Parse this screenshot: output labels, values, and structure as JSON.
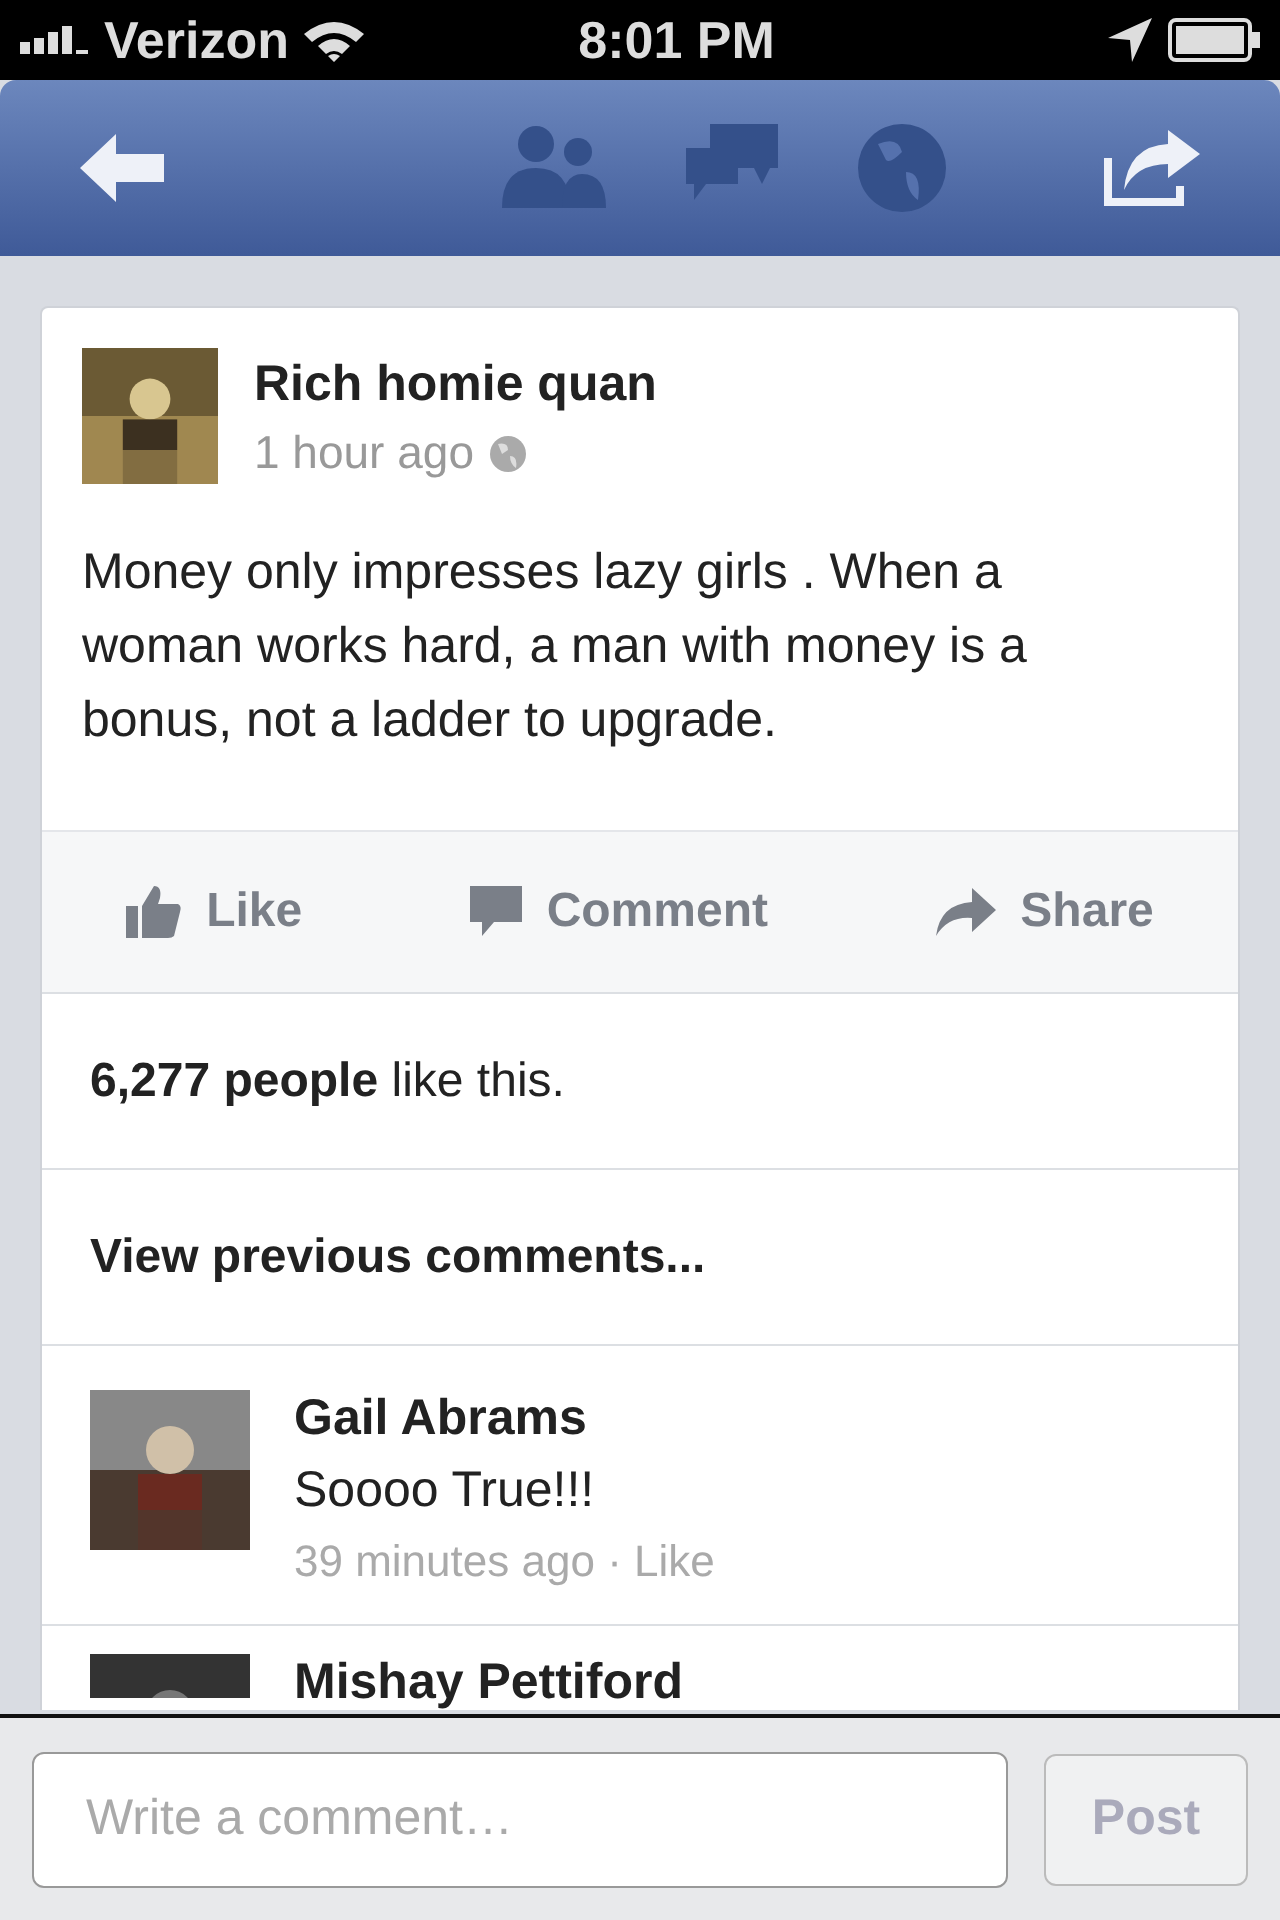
{
  "status_bar": {
    "carrier": "Verizon",
    "time": "8:01 PM"
  },
  "post": {
    "author": "Rich homie quan",
    "time": "1 hour ago",
    "text": "Money only impresses lazy girls . When a woman works hard, a man with money is a bonus, not a ladder to upgrade."
  },
  "actions": [
    {
      "kind": "like",
      "label": "Like"
    },
    {
      "kind": "comment",
      "label": "Comment"
    },
    {
      "kind": "share",
      "label": "Share"
    }
  ],
  "likes": "**6,277 people** like this.",
  "view_previous": "View previous comments...",
  "comments": [
    {
      "name": "Gail Abrams",
      "text": "Soooo True!!!",
      "time": "39 minutes ago",
      "separator": "·",
      "like": "Like"
    },
    {
      "name": "Mishay Pettiford"
    }
  ],
  "composer": {
    "placeholder": "Write a comment…",
    "button": "Post",
    "disabled": true
  }
}
